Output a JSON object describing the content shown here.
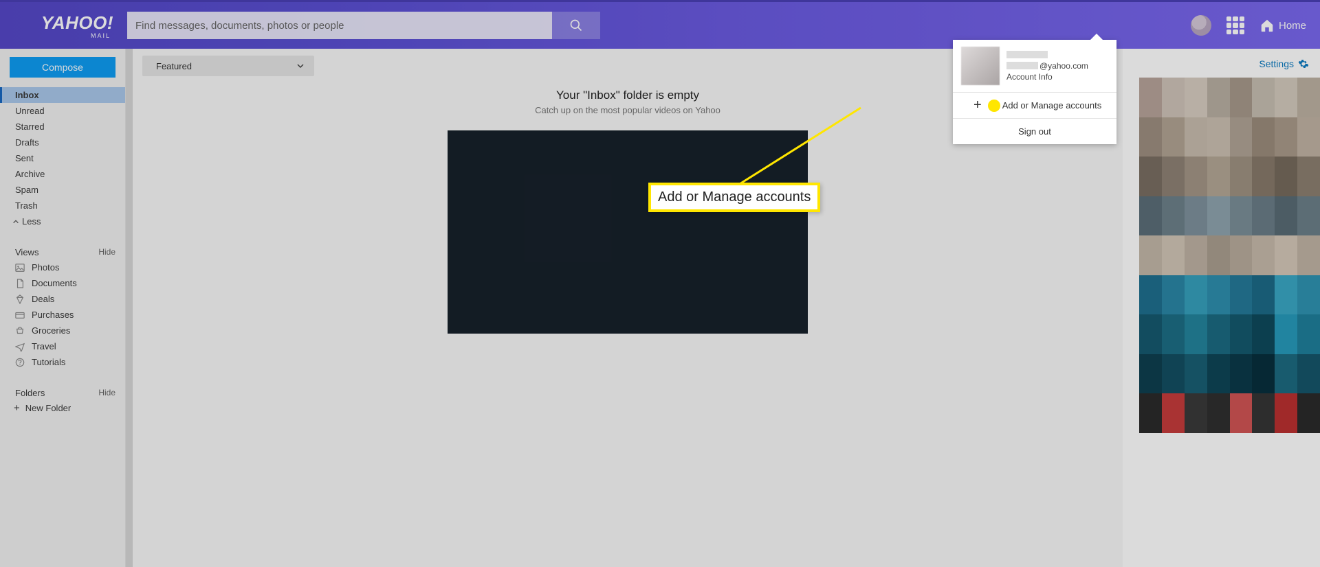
{
  "header": {
    "logo_main": "YAHOO!",
    "logo_sub": "MAIL",
    "search_placeholder": "Find messages, documents, photos or people",
    "home_label": "Home"
  },
  "sidebar": {
    "compose_label": "Compose",
    "folders": [
      "Inbox",
      "Unread",
      "Starred",
      "Drafts",
      "Sent",
      "Archive",
      "Spam",
      "Trash"
    ],
    "selected_folder_index": 0,
    "less_label": "Less",
    "views_header": "Views",
    "views_hide": "Hide",
    "views": [
      "Photos",
      "Documents",
      "Deals",
      "Purchases",
      "Groceries",
      "Travel",
      "Tutorials"
    ],
    "folders_header": "Folders",
    "folders_hide": "Hide",
    "new_folder_label": "New Folder"
  },
  "main": {
    "featured_label": "Featured",
    "empty_title": "Your \"Inbox\" folder is empty",
    "empty_sub": "Catch up on the most popular videos on Yahoo"
  },
  "right": {
    "settings_label": "Settings"
  },
  "account_popover": {
    "email_suffix": "@yahoo.com",
    "account_info_label": "Account Info",
    "add_manage_label": "Add or Manage accounts",
    "sign_out_label": "Sign out"
  },
  "callout": {
    "text": "Add or Manage accounts"
  }
}
